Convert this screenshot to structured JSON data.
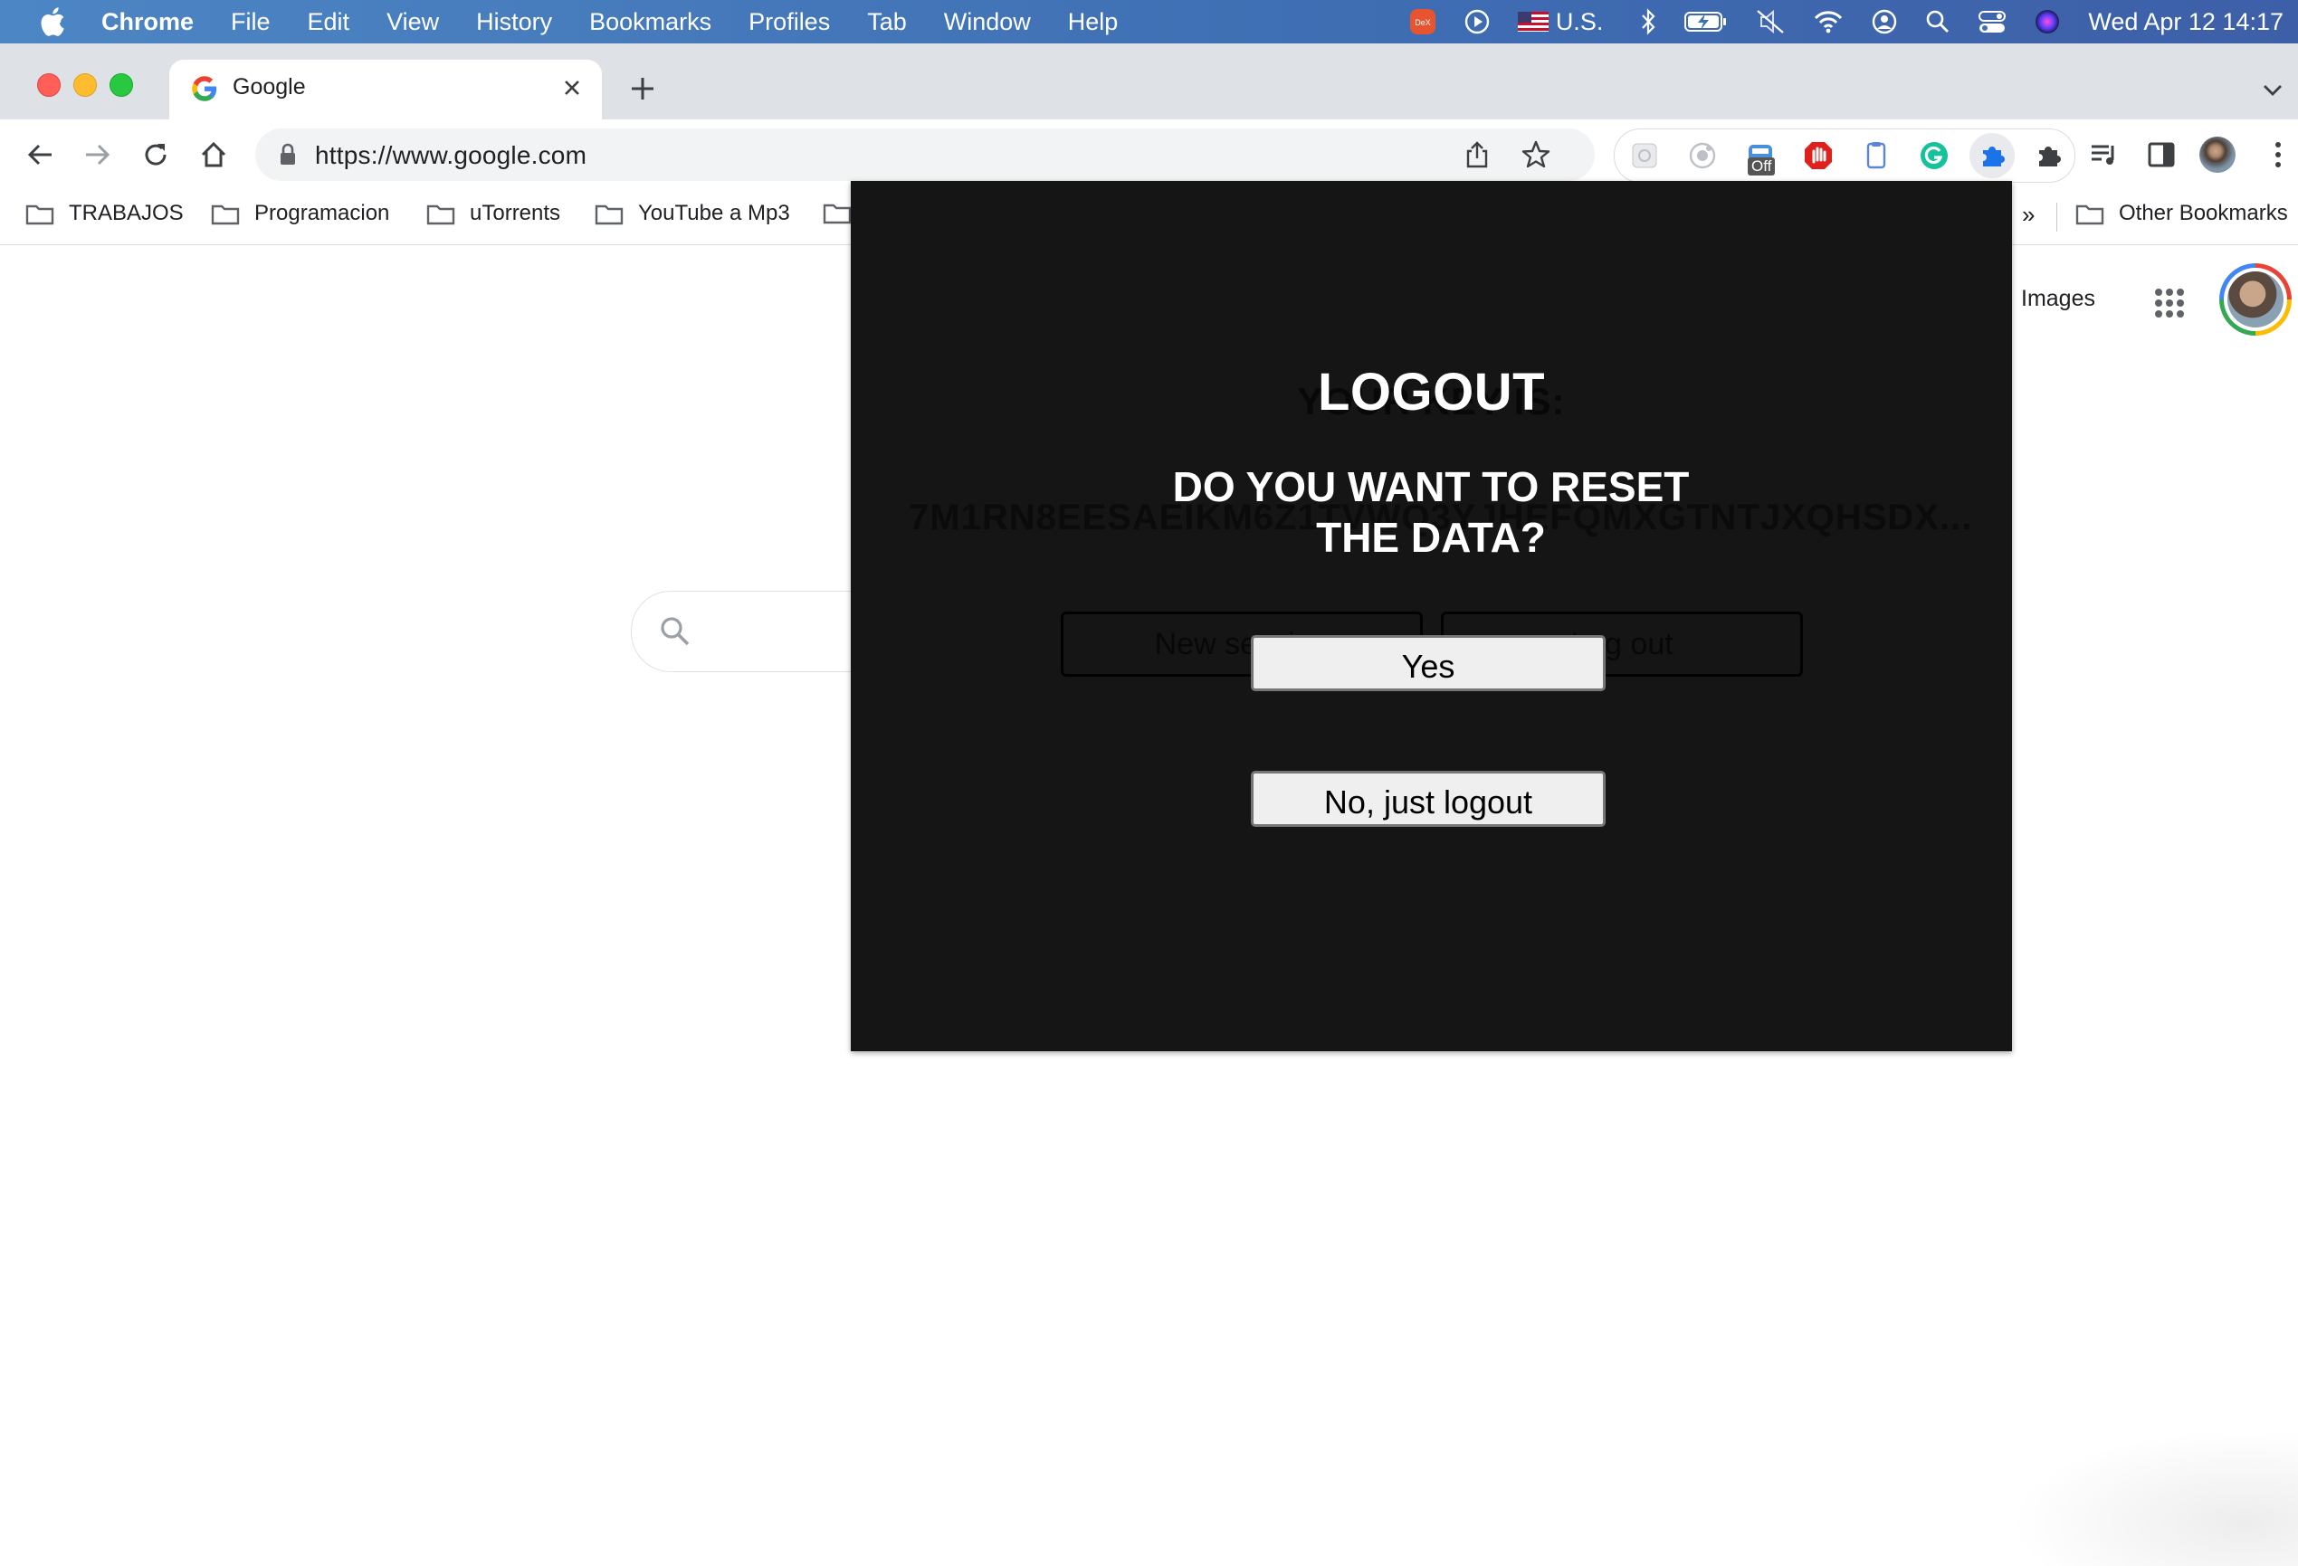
{
  "menubar": {
    "app_name": "Chrome",
    "items": [
      "File",
      "Edit",
      "View",
      "History",
      "Bookmarks",
      "Profiles",
      "Tab",
      "Window",
      "Help"
    ],
    "keyboard_layout": "U.S.",
    "clock": "Wed Apr 12  14:17"
  },
  "tab": {
    "title": "Google"
  },
  "omnibox": {
    "url": "https://www.google.com"
  },
  "extensions": {
    "off_badge": "Off"
  },
  "bookmarks": {
    "items": [
      "TRABAJOS",
      "Programacion",
      "uTorrents",
      "YouTube a Mp3"
    ],
    "overflow": "»",
    "other": "Other Bookmarks"
  },
  "google": {
    "images_link": "Images"
  },
  "popup": {
    "background_heading": "YOUR KEY IS:",
    "background_key": "7M1RN8EESAEIKM6Z1TVWQ3YJHEFQMXGTNTJXQHSDX...",
    "background_buttons": [
      "New session",
      "Log out"
    ],
    "title": "LOGOUT",
    "question_line1": "DO YOU WANT TO RESET",
    "question_line2": "THE DATA?",
    "yes_label": "Yes",
    "no_label": "No, just logout"
  },
  "colors": {
    "menubar": "#3f6fb4",
    "popup_background": "#151515",
    "button_background": "#efefef",
    "tabstrip": "#dee1e6"
  }
}
